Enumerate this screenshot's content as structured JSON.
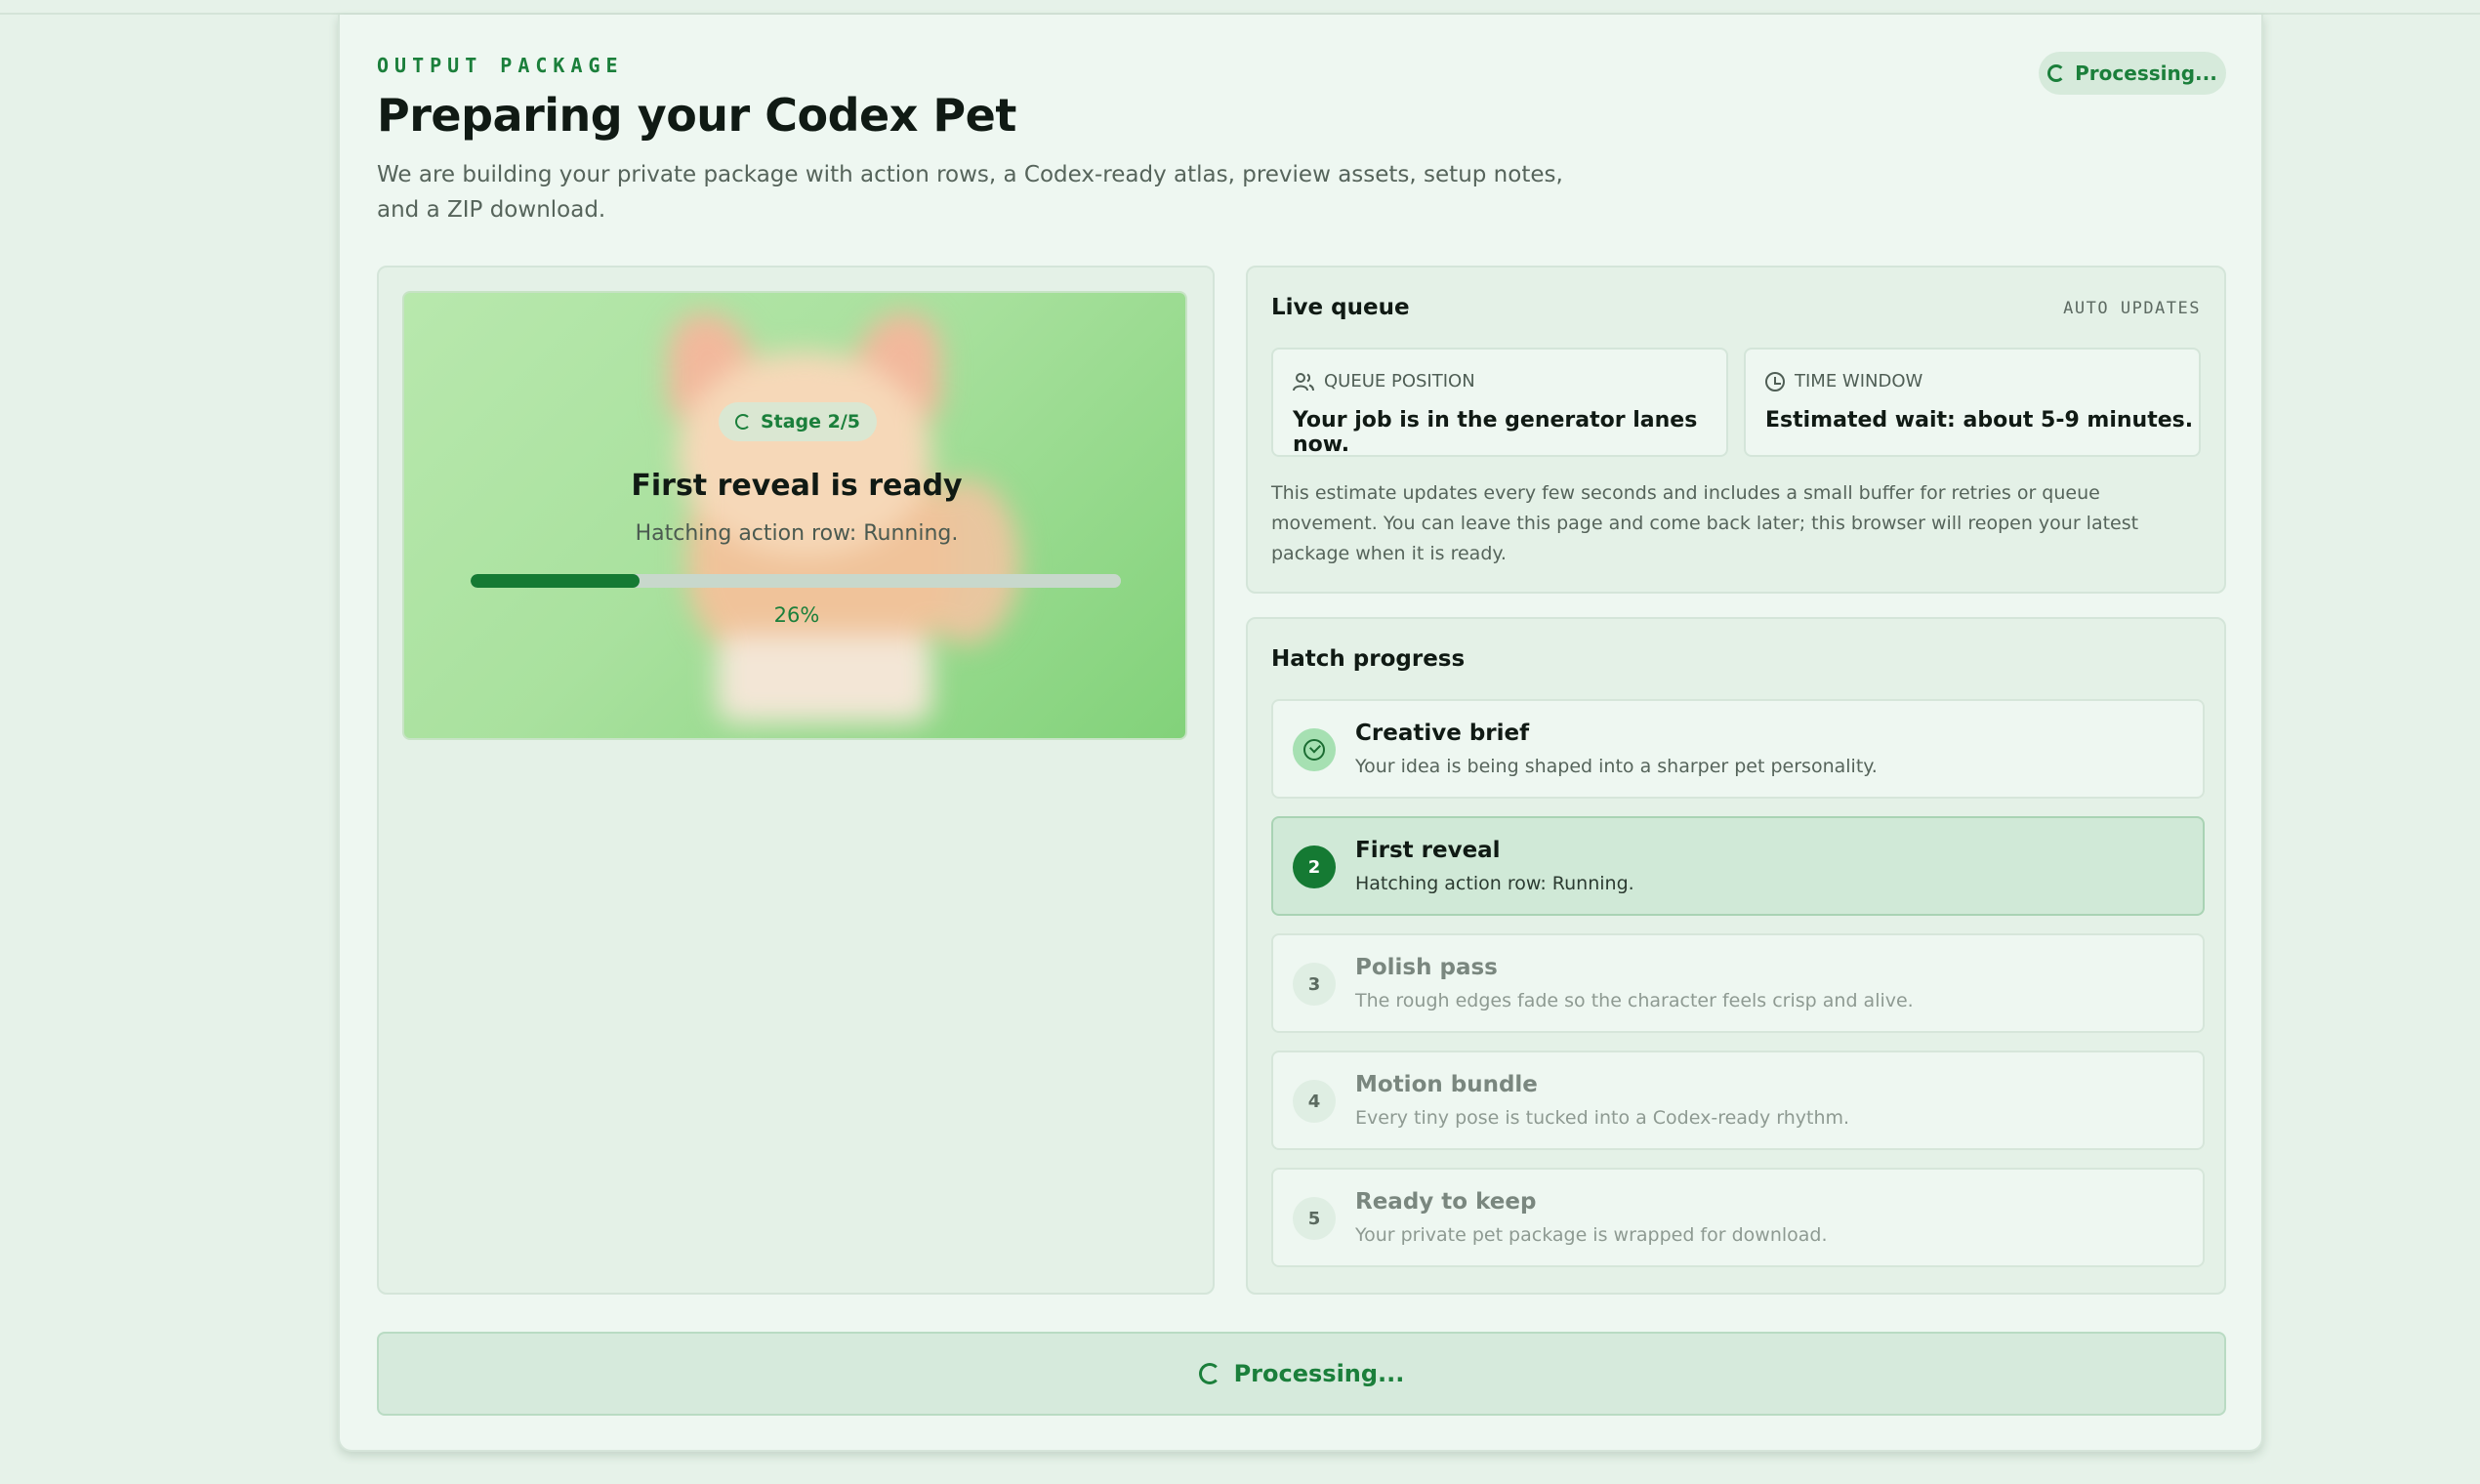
{
  "header": {
    "eyebrow": "OUTPUT PACKAGE",
    "title": "Preparing your Codex Pet",
    "subtitle": "We are building your private package with action rows, a Codex-ready atlas, preview assets, setup notes, and a ZIP download.",
    "status_pill": "Processing..."
  },
  "preview": {
    "stage_label": "Stage 2/5",
    "title": "First reveal is ready",
    "subtitle": "Hatching action row: Running.",
    "progress": 26,
    "progress_label": "26%"
  },
  "queue": {
    "title": "Live queue",
    "auto_label": "AUTO UPDATES",
    "position_label": "QUEUE POSITION",
    "position_text": "Your job is in the generator lanes now.",
    "window_label": "TIME WINDOW",
    "window_text": "Estimated wait: about 5-9 minutes.",
    "note": "This estimate updates every few seconds and includes a small buffer for retries or queue movement. You can leave this page and come back later; this browser will reopen your latest package when it is ready."
  },
  "hatch": {
    "title": "Hatch progress",
    "steps": [
      {
        "num": "",
        "title": "Creative brief",
        "desc": "Your idea is being shaped into a sharper pet personality.",
        "state": "done"
      },
      {
        "num": "2",
        "title": "First reveal",
        "desc": "Hatching action row: Running.",
        "state": "active"
      },
      {
        "num": "3",
        "title": "Polish pass",
        "desc": "The rough edges fade so the character feels crisp and alive.",
        "state": "pending"
      },
      {
        "num": "4",
        "title": "Motion bundle",
        "desc": "Every tiny pose is tucked into a Codex-ready rhythm.",
        "state": "pending"
      },
      {
        "num": "5",
        "title": "Ready to keep",
        "desc": "Your private pet package is wrapped for download.",
        "state": "pending"
      }
    ]
  },
  "footer": {
    "button_label": "Processing..."
  },
  "colors": {
    "accent": "#1b7f3b",
    "progress_fill": "#157a33",
    "background": "#e6f2e9"
  }
}
